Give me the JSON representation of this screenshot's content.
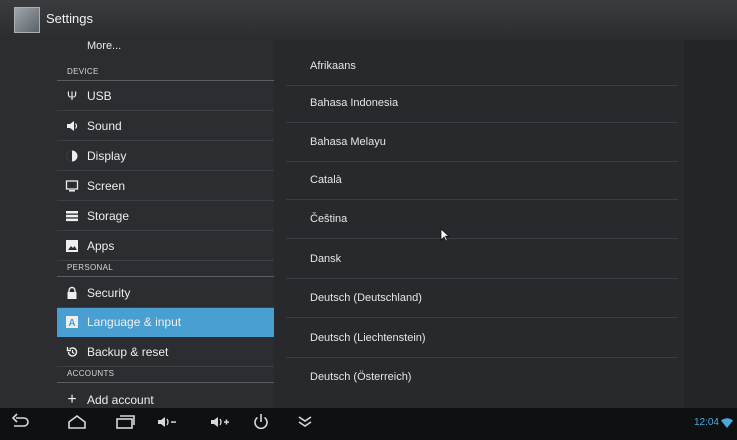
{
  "app": {
    "title": "Settings"
  },
  "sidebar": {
    "more_label": "More...",
    "sections": {
      "device": "DEVICE",
      "personal": "PERSONAL",
      "accounts": "ACCOUNTS"
    },
    "items": {
      "usb": "USB",
      "sound": "Sound",
      "display": "Display",
      "screen": "Screen",
      "storage": "Storage",
      "apps": "Apps",
      "security": "Security",
      "language": "Language & input",
      "backup": "Backup & reset",
      "add_account": "Add account"
    },
    "selected": "Language & input"
  },
  "languages": [
    "Afrikaans",
    "Bahasa Indonesia",
    "Bahasa Melayu",
    "Català",
    "Čeština",
    "Dansk",
    "Deutsch (Deutschland)",
    "Deutsch (Liechtenstein)",
    "Deutsch (Österreich)"
  ],
  "status": {
    "time": "12:04"
  },
  "colors": {
    "accent": "#4a9fd2",
    "clock": "#4aa9e0"
  }
}
